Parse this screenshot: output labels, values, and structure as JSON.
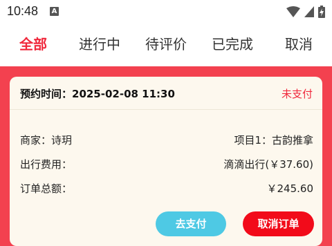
{
  "status_bar": {
    "time": "10:48",
    "notification_icon": "A"
  },
  "tabs": [
    {
      "label": "全部",
      "active": true
    },
    {
      "label": "进行中",
      "active": false
    },
    {
      "label": "待评价",
      "active": false
    },
    {
      "label": "已完成",
      "active": false
    },
    {
      "label": "取消",
      "active": false
    }
  ],
  "order": {
    "appointment": "预约时间：2025-02-08 11:30",
    "status": "未支付",
    "merchant": "商家：诗玥",
    "project": "项目1：古韵推拿",
    "travel_fee_label": "出行费用：",
    "travel_fee_value": "滴滴出行(￥37.60)",
    "total_label": "订单总额：",
    "total_value": "￥245.60",
    "pay_button": "去支付",
    "cancel_button": "取消订单"
  },
  "colors": {
    "accent": "#f0283c",
    "background": "#f3414f",
    "card": "#fdf8ee",
    "pay": "#4ec9e4",
    "cancel": "#f20b1a"
  }
}
